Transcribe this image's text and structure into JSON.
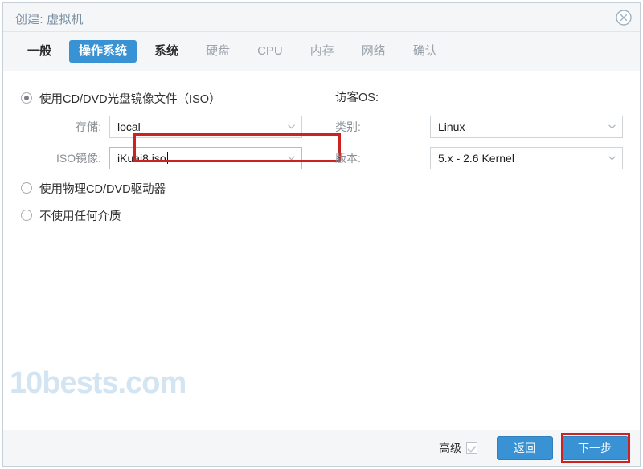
{
  "window": {
    "title": "创建: 虚拟机",
    "close_icon": "close-circle-icon"
  },
  "tabs": [
    {
      "label": "一般",
      "state": "visited"
    },
    {
      "label": "操作系统",
      "state": "active"
    },
    {
      "label": "系统",
      "state": "visited"
    },
    {
      "label": "硬盘",
      "state": "disabled"
    },
    {
      "label": "CPU",
      "state": "disabled"
    },
    {
      "label": "内存",
      "state": "disabled"
    },
    {
      "label": "网络",
      "state": "disabled"
    },
    {
      "label": "确认",
      "state": "disabled"
    }
  ],
  "media": {
    "option_iso": "使用CD/DVD光盘镜像文件（ISO）",
    "option_physical": "使用物理CD/DVD驱动器",
    "option_none": "不使用任何介质",
    "storage_label": "存储:",
    "storage_value": "local",
    "iso_label": "ISO镜像:",
    "iso_value": "iKuai8.iso"
  },
  "guest_os": {
    "heading": "访客OS:",
    "type_label": "类别:",
    "type_value": "Linux",
    "version_label": "版本:",
    "version_value": "5.x - 2.6 Kernel"
  },
  "footer": {
    "advanced_label": "高级",
    "back_label": "返回",
    "next_label": "下一步"
  },
  "watermark": {
    "text": "10bests.com"
  },
  "colors": {
    "accent": "#3892d4",
    "highlight": "#cc2222",
    "title_text": "#7b8fa3",
    "watermark": "#d3e4f2"
  }
}
